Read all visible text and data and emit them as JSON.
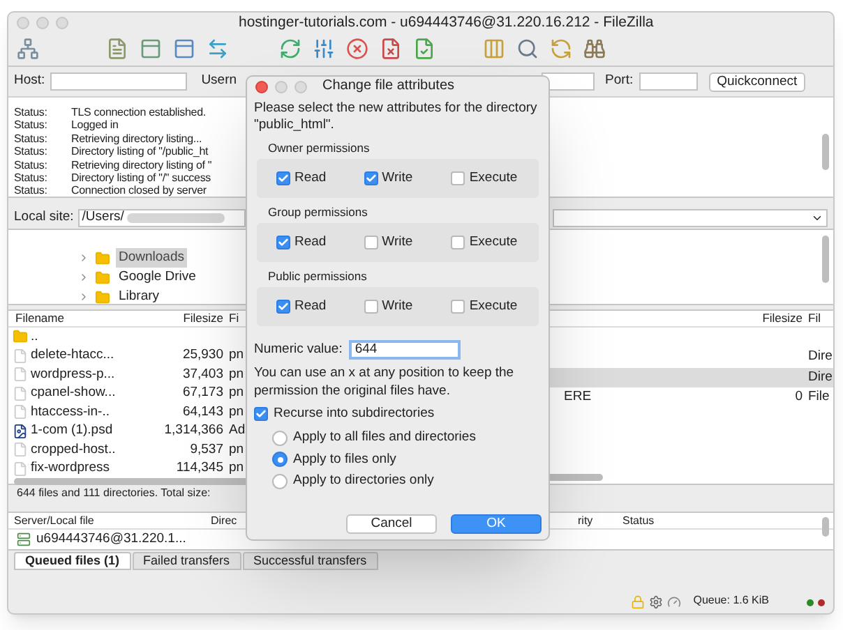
{
  "window": {
    "title": "hostinger-tutorials.com - u694443746@31.220.16.212 - FileZilla"
  },
  "quickconnect": {
    "host_label": "Host:",
    "username_label": "Usern",
    "port_label": "Port:",
    "button": "Quickconnect"
  },
  "message_log": [
    {
      "label": "Status:",
      "message": "TLS connection established."
    },
    {
      "label": "Status:",
      "message": "Logged in"
    },
    {
      "label": "Status:",
      "message": "Retrieving directory listing..."
    },
    {
      "label": "Status:",
      "message": "Directory listing of \"/public_ht"
    },
    {
      "label": "Status:",
      "message": "Retrieving directory listing of \""
    },
    {
      "label": "Status:",
      "message": "Directory listing of \"/\" success"
    },
    {
      "label": "Status:",
      "message": "Connection closed by server"
    }
  ],
  "local_site": {
    "label": "Local site:",
    "path": "/Users/"
  },
  "local_tree": [
    {
      "name": "Downloads",
      "selected": true
    },
    {
      "name": "Google Drive",
      "selected": false
    },
    {
      "name": "Library",
      "selected": false
    }
  ],
  "local_files": {
    "columns": [
      "Filename",
      "Filesize",
      "Fi"
    ],
    "rows": [
      {
        "kind": "folder",
        "name": ".."
      },
      {
        "kind": "file",
        "name": "delete-htacc...",
        "size": "25,930",
        "type": "pn"
      },
      {
        "kind": "file",
        "name": "wordpress-p...",
        "size": "37,403",
        "type": "pn"
      },
      {
        "kind": "file",
        "name": "cpanel-show...",
        "size": "67,173",
        "type": "pn"
      },
      {
        "kind": "file",
        "name": "htaccess-in-..",
        "size": "64,143",
        "type": "pn"
      },
      {
        "kind": "psd",
        "name": "1-com (1).psd",
        "size": "1,314,366",
        "type": "Ad"
      },
      {
        "kind": "file",
        "name": "cropped-host..",
        "size": "9,537",
        "type": "pn"
      },
      {
        "kind": "file",
        "name": "fix-wordpress",
        "size": "114,345",
        "type": "pn"
      }
    ]
  },
  "local_status": "644 files and 111 directories. Total size:",
  "remote_files": {
    "columns": [
      "Filesize",
      "Fil"
    ],
    "rows": [
      {
        "type": "Dire",
        "selected": false
      },
      {
        "type": "Dire",
        "selected": true
      },
      {
        "name": "ERE",
        "size": "0",
        "type": "File",
        "selected": false
      }
    ]
  },
  "queue": {
    "columns": [
      "Server/Local file",
      "Direc",
      "rity",
      "Status"
    ],
    "rows": [
      {
        "server": "u694443746@31.220.1..."
      }
    ]
  },
  "queue_tabs": [
    {
      "label": "Queued files (1)",
      "selected": true
    },
    {
      "label": "Failed transfers",
      "selected": false
    },
    {
      "label": "Successful transfers",
      "selected": false
    }
  ],
  "status_bar": {
    "queue": "Queue: 1.6 KiB"
  },
  "dialog": {
    "title": "Change file attributes",
    "message": "Please select the new attributes for the directory \"public_html\".",
    "groups": [
      {
        "title": "Owner permissions",
        "permissions": [
          {
            "label": "Read",
            "checked": true
          },
          {
            "label": "Write",
            "checked": true
          },
          {
            "label": "Execute",
            "checked": false
          }
        ]
      },
      {
        "title": "Group permissions",
        "permissions": [
          {
            "label": "Read",
            "checked": true
          },
          {
            "label": "Write",
            "checked": false
          },
          {
            "label": "Execute",
            "checked": false
          }
        ]
      },
      {
        "title": "Public permissions",
        "permissions": [
          {
            "label": "Read",
            "checked": true
          },
          {
            "label": "Write",
            "checked": false
          },
          {
            "label": "Execute",
            "checked": false
          }
        ]
      }
    ],
    "numeric_label": "Numeric value:",
    "numeric_value": "644",
    "hint": "You can use an x at any position to keep the permission the original files have.",
    "recurse": {
      "label": "Recurse into subdirectories",
      "checked": true
    },
    "apply_options": [
      {
        "label": "Apply to all files and directories",
        "selected": false
      },
      {
        "label": "Apply to files only",
        "selected": true
      },
      {
        "label": "Apply to directories only",
        "selected": false
      }
    ],
    "buttons": [
      {
        "label": "Cancel",
        "kind": "secondary"
      },
      {
        "label": "OK",
        "kind": "primary"
      }
    ]
  }
}
